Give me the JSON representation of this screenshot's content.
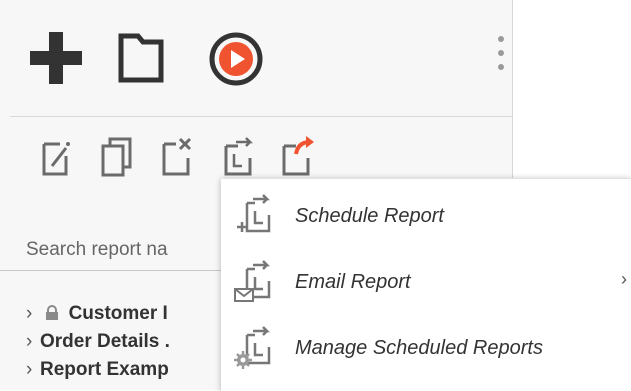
{
  "toolbar": {
    "add_icon": "plus-icon",
    "folder_icon": "folder-icon",
    "run_icon": "play-circle-icon",
    "more_icon": "kebab-icon",
    "accent_color": "#f0532f"
  },
  "actions": {
    "icons": [
      "edit-icon",
      "copy-icon",
      "delete-icon",
      "schedule-icon",
      "share-icon"
    ]
  },
  "search": {
    "placeholder": "Search report na"
  },
  "tree": {
    "items": [
      {
        "label": "Customer I",
        "locked": true
      },
      {
        "label": "Order Details ."
      },
      {
        "label": "Report Examp"
      }
    ]
  },
  "menu": {
    "items": [
      {
        "label": "Schedule Report",
        "icon": "schedule-report-icon"
      },
      {
        "label": "Email Report",
        "icon": "email-report-icon",
        "has_submenu": true,
        "submenu_indicator": "›"
      },
      {
        "label": "Manage Scheduled Reports",
        "icon": "manage-schedule-icon"
      }
    ]
  }
}
